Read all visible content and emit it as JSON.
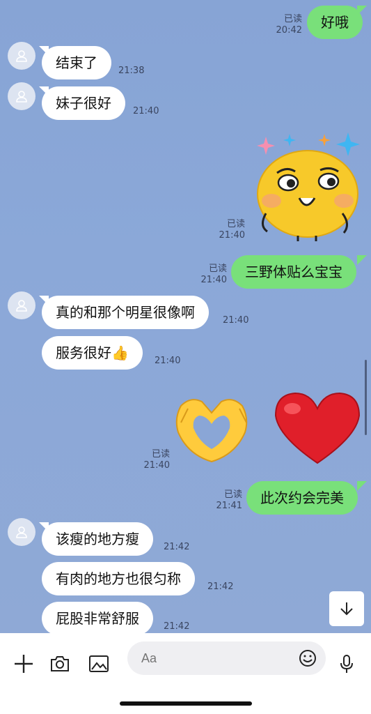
{
  "messages": {
    "m1": {
      "text": "好哦",
      "status": "已读",
      "time": "20:42"
    },
    "m2": {
      "text": "结束了",
      "time": "21:38"
    },
    "m3": {
      "text": "妹子很好",
      "time": "21:40"
    },
    "m4": {
      "sticker": "smug-face-sticker",
      "status": "已读",
      "time": "21:40"
    },
    "m5": {
      "text": "三野体贴么宝宝",
      "status": "已读",
      "time": "21:40"
    },
    "m6": {
      "text": "真的和那个明星很像啊",
      "time": "21:40"
    },
    "m7": {
      "text": "服务很好👍",
      "time": "21:40"
    },
    "m8": {
      "sticker": "heart-hands-and-red-heart",
      "status": "已读",
      "time": "21:40"
    },
    "m9": {
      "text": "此次约会完美",
      "status": "已读",
      "time": "21:41"
    },
    "m10": {
      "text": "该瘦的地方瘦",
      "time": "21:42"
    },
    "m11": {
      "text": "有肉的地方也很匀称",
      "time": "21:42"
    },
    "m12": {
      "text": "屁股非常舒服",
      "time": "21:42"
    }
  },
  "composer": {
    "placeholder": "Aa"
  },
  "colors": {
    "outgoing": "#79e07a",
    "incoming": "#ffffff",
    "background": "#8aa6d6"
  }
}
